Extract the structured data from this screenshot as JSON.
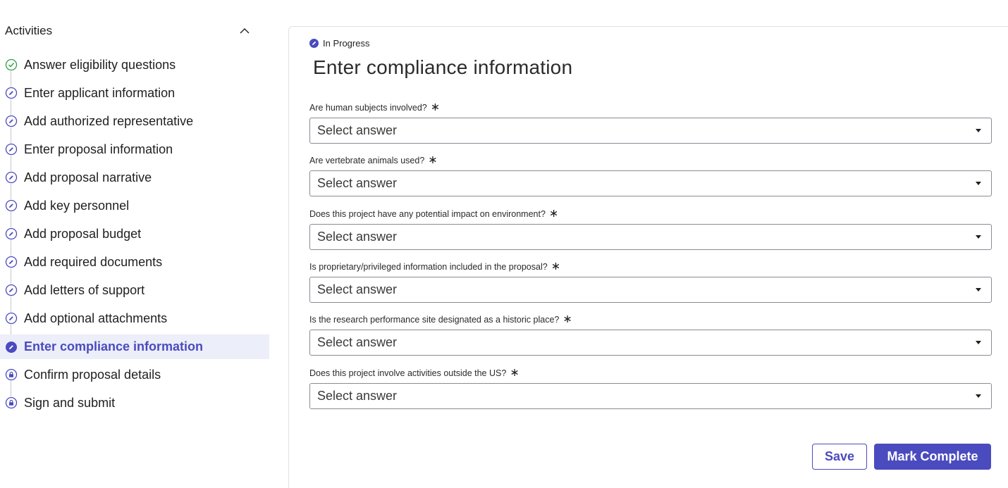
{
  "sidebar": {
    "title": "Activities",
    "steps": [
      {
        "label": "Answer eligibility questions",
        "state": "complete",
        "icon": "check-circle-icon"
      },
      {
        "label": "Enter applicant information",
        "state": "in-progress",
        "icon": "pencil-circle-icon"
      },
      {
        "label": "Add authorized representative",
        "state": "in-progress",
        "icon": "pencil-circle-icon"
      },
      {
        "label": "Enter proposal information",
        "state": "in-progress",
        "icon": "pencil-circle-icon"
      },
      {
        "label": "Add proposal narrative",
        "state": "in-progress",
        "icon": "pencil-circle-icon"
      },
      {
        "label": "Add key personnel",
        "state": "in-progress",
        "icon": "pencil-circle-icon"
      },
      {
        "label": "Add proposal budget",
        "state": "in-progress",
        "icon": "pencil-circle-icon"
      },
      {
        "label": "Add required documents",
        "state": "in-progress",
        "icon": "pencil-circle-icon"
      },
      {
        "label": "Add letters of support",
        "state": "in-progress",
        "icon": "pencil-circle-icon"
      },
      {
        "label": "Add optional attachments",
        "state": "in-progress",
        "icon": "pencil-circle-icon"
      },
      {
        "label": "Enter compliance information",
        "state": "current",
        "icon": "pencil-circle-filled-icon"
      },
      {
        "label": "Confirm proposal details",
        "state": "locked",
        "icon": "lock-circle-icon"
      },
      {
        "label": "Sign and submit",
        "state": "locked",
        "icon": "lock-circle-icon"
      }
    ]
  },
  "main": {
    "status": "In Progress",
    "title": "Enter compliance information",
    "required_marker": "∗",
    "fields": [
      {
        "label": "Are human subjects involved?",
        "value": "Select answer"
      },
      {
        "label": "Are vertebrate animals used?",
        "value": "Select answer"
      },
      {
        "label": "Does this project have any potential impact on environment?",
        "value": "Select answer"
      },
      {
        "label": "Is proprietary/privileged information included in the proposal?",
        "value": "Select answer"
      },
      {
        "label": "Is the research performance site designated as a historic place?",
        "value": "Select answer"
      },
      {
        "label": "Does this project involve activities outside the US?",
        "value": "Select answer"
      }
    ],
    "save_label": "Save",
    "complete_label": "Mark Complete"
  },
  "colors": {
    "accent": "#4a4bbf",
    "complete": "#2f9e44",
    "current_bg": "#eceef9"
  }
}
